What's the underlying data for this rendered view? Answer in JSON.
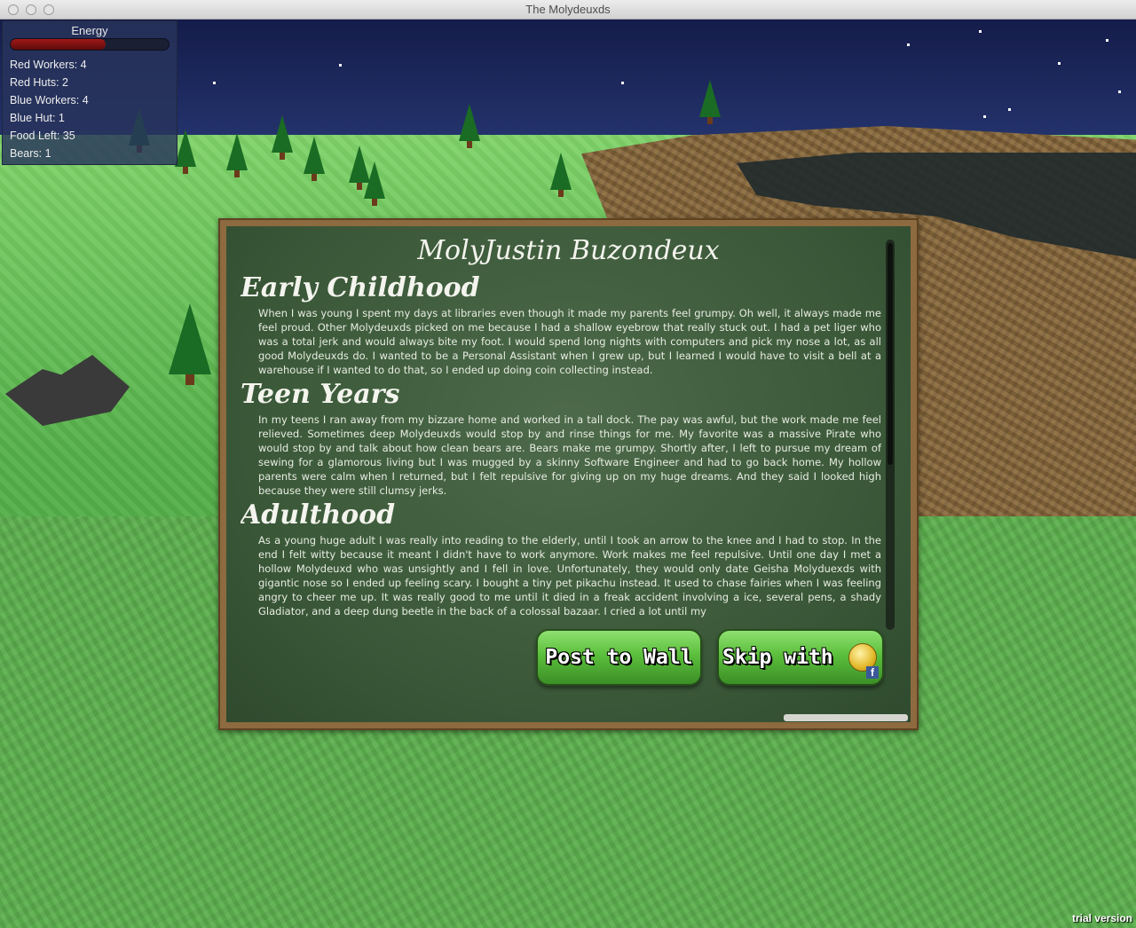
{
  "window": {
    "title": "The Molydeuxds"
  },
  "hud": {
    "energy_label": "Energy",
    "energy_level": 0.6,
    "stats": [
      "Red Workers: 4",
      "Red Huts: 2",
      "Blue Workers: 4",
      "Blue Hut: 1",
      "Food Left: 35",
      "Bears: 1"
    ]
  },
  "dialog": {
    "title": "MolyJustin Buzondeux",
    "sections": [
      {
        "heading": "Early Childhood",
        "body": "When I was young I spent my days at libraries even though it made my parents feel grumpy. Oh well, it always made me feel proud. Other Molydeuxds picked on me because I had a shallow eyebrow that really stuck out. I had a pet liger who was a total jerk and would always bite my foot. I would spend long nights with computers and pick my nose a lot, as all good Molydeuxds do. I wanted to be a Personal Assistant when I grew up, but I learned I would have to visit a bell at a warehouse if I wanted to do that, so I ended up doing coin collecting instead."
      },
      {
        "heading": "Teen Years",
        "body": "In my teens I ran away from my bizzare home and worked in a tall dock. The pay was awful, but the work made me feel relieved. Sometimes deep Molydeuxds would stop by and rinse things for me. My favorite was a massive Pirate who would stop by and talk about how clean bears are. Bears make me grumpy. Shortly after, I left to pursue my dream of sewing for a glamorous living but I was mugged by a skinny Software Engineer and had to go back home. My hollow parents were calm when I returned, but I felt repulsive for giving up on my huge dreams. And they said I looked high because they were still clumsy jerks."
      },
      {
        "heading": "Adulthood",
        "body": "As a young huge adult I was really into reading to the elderly, until I took an arrow to the knee and I had to stop. In the end I felt witty because it meant I didn't have to work anymore. Work makes me feel repulsive. Until one day I met a hollow Molydeuxd who was unsightly and I fell in love. Unfortunately, they would only date Geisha Molyduexds with gigantic nose so I ended up feeling scary. I bought a tiny pet pikachu instead. It used to chase fairies when I was feeling angry to cheer me up. It was really good to me until it died in a freak accident involving a ice, several pens, a shady Gladiator, and a deep dung beetle in the back of a colossal bazaar. I cried a lot until my"
      }
    ],
    "post_button": "Post to Wall",
    "skip_button": "Skip with",
    "fb_glyph": "f"
  },
  "watermark": "trial version",
  "colors": {
    "chalkboard": "#3c5a3a",
    "frame": "#8d6a3f",
    "button_green": "#5bbf3c",
    "energy_red": "#a01818"
  }
}
